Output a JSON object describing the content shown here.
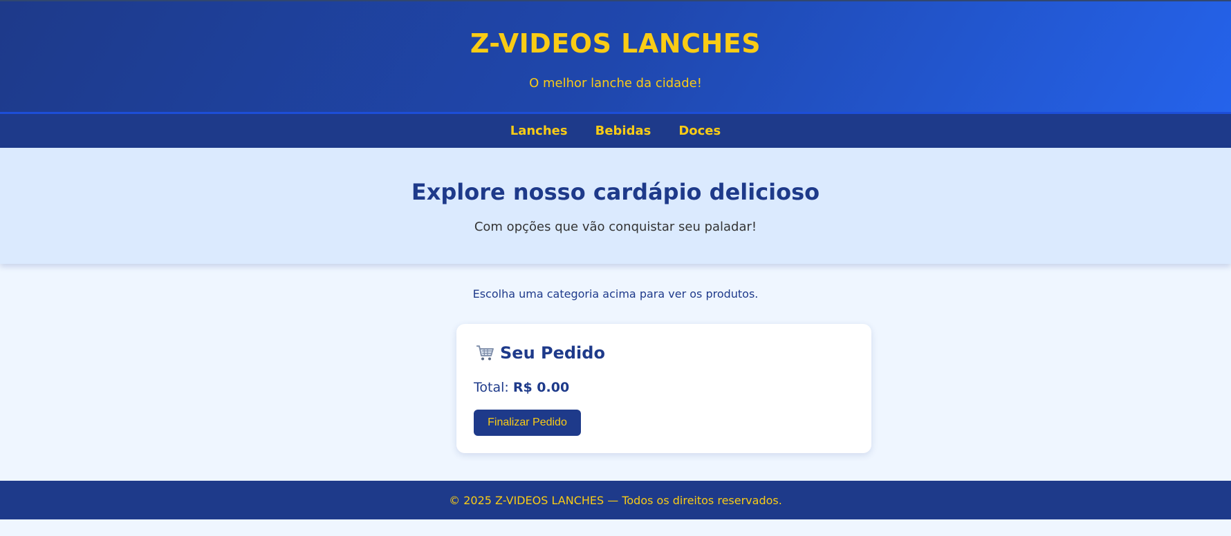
{
  "colors": {
    "primary": "#1e3a8a",
    "accent": "#facc15",
    "header_gradient_end": "#2563eb",
    "hero_bg": "#dbeafe",
    "page_bg": "#eff6ff"
  },
  "header": {
    "title": "Z-VIDEOS LANCHES",
    "tagline": "O melhor lanche da cidade!"
  },
  "nav": {
    "items": [
      {
        "label": "Lanches"
      },
      {
        "label": "Bebidas"
      },
      {
        "label": "Doces"
      }
    ]
  },
  "hero": {
    "title": "Explore nosso cardápio delicioso",
    "subtitle": "Com opções que vão conquistar seu paladar!"
  },
  "main": {
    "hint": "Escolha uma categoria acima para ver os produtos."
  },
  "order": {
    "icon": "shopping-cart-icon",
    "title": "Seu Pedido",
    "total_label": "Total:",
    "total_value": "R$ 0.00",
    "finalize_label": "Finalizar Pedido"
  },
  "footer": {
    "text": "© 2025 Z-VIDEOS LANCHES — Todos os direitos reservados."
  }
}
